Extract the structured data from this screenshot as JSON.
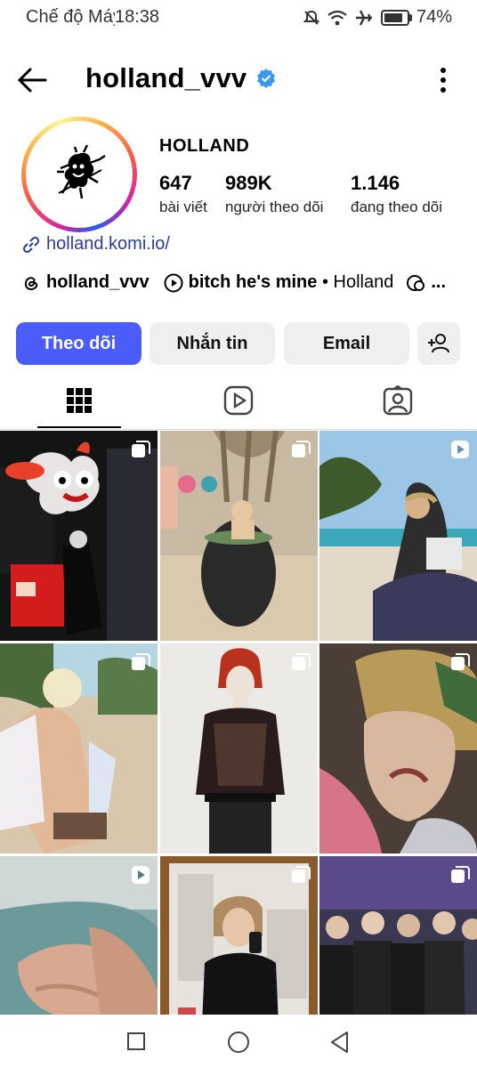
{
  "status_bar": {
    "mode": "Chế độ Máy bay",
    "time": "18:38",
    "battery": "74%"
  },
  "header": {
    "username": "holland_vvv"
  },
  "profile": {
    "full_name": "HOLLAND",
    "posts_count": "647",
    "posts_label": "bài viết",
    "followers_count": "989K",
    "followers_label": "người theo dõi",
    "following_count": "1.146",
    "following_label": "đang theo dõi",
    "link": "holland.komi.io/",
    "threads_handle": "holland_vvv",
    "music_title": "bitch he's mine",
    "music_sep": " • ",
    "music_artist": "Holland",
    "more_dots": "..."
  },
  "actions": {
    "follow": "Theo dõi",
    "message": "Nhắn tin",
    "email": "Email"
  },
  "tabs": [
    {
      "icon": "grid-icon"
    },
    {
      "icon": "reels-icon"
    },
    {
      "icon": "tagged-icon"
    }
  ],
  "posts": [
    {
      "type": "carousel"
    },
    {
      "type": "carousel"
    },
    {
      "type": "reel"
    },
    {
      "type": "carousel"
    },
    {
      "type": "carousel"
    },
    {
      "type": "carousel"
    },
    {
      "type": "reel"
    },
    {
      "type": "carousel"
    },
    {
      "type": "carousel"
    }
  ],
  "colors": {
    "accent": "#4a5df9",
    "link": "#2b3c9b",
    "verified": "#3897f0"
  }
}
